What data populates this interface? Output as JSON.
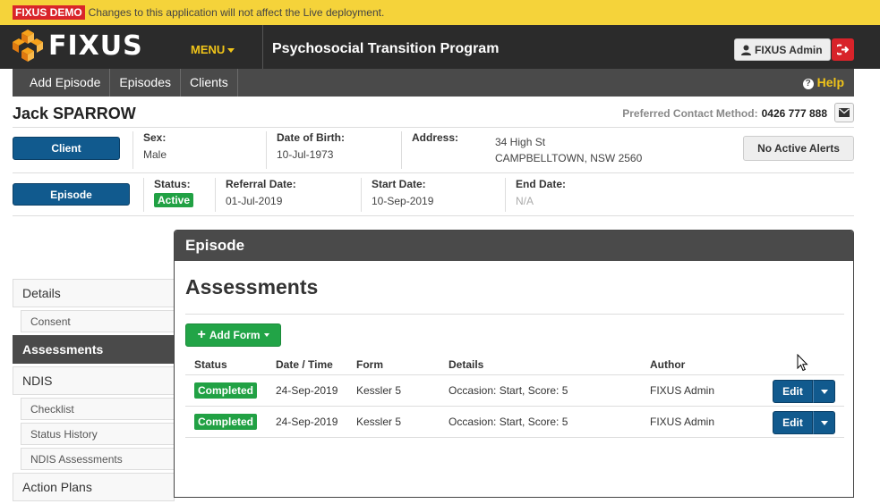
{
  "demo": {
    "badge": "FIXUS DEMO",
    "message": "Changes to this application will not affect the Live deployment."
  },
  "topnav": {
    "logo_text": "FIXUS",
    "menu_label": "MENU",
    "program_title": "Psychosocial Transition Program",
    "user_label": "FIXUS Admin",
    "logout_icon": "logout-icon"
  },
  "subnav": {
    "items": [
      "Add Episode",
      "Episodes",
      "Clients"
    ],
    "help_label": "Help"
  },
  "client": {
    "name": "Jack SPARROW",
    "contact_label": "Preferred Contact Method:",
    "contact_value": "0426 777 888",
    "client_button": "Client",
    "sex_label": "Sex:",
    "sex_value": "Male",
    "dob_label": "Date of Birth:",
    "dob_value": "10-Jul-1973",
    "address_label": "Address:",
    "address_line1": "34 High St",
    "address_line2": "CAMPBELLTOWN, NSW 2560",
    "alerts_button": "No Active Alerts"
  },
  "episode": {
    "episode_button": "Episode",
    "status_label": "Status:",
    "status_value": "Active",
    "referral_label": "Referral Date:",
    "referral_value": "01-Jul-2019",
    "start_label": "Start Date:",
    "start_value": "10-Sep-2019",
    "end_label": "End Date:",
    "end_value": "N/A"
  },
  "sidebar": {
    "items": [
      {
        "label": "Details"
      },
      {
        "label": "Consent"
      },
      {
        "label": "Assessments"
      },
      {
        "label": "NDIS"
      },
      {
        "label": "Checklist"
      },
      {
        "label": "Status History"
      },
      {
        "label": "NDIS Assessments"
      },
      {
        "label": "Action Plans"
      }
    ]
  },
  "panel": {
    "header": "Episode",
    "title": "Assessments",
    "add_form_label": "Add Form",
    "columns": [
      "Status",
      "Date / Time",
      "Form",
      "Details",
      "Author"
    ],
    "rows": [
      {
        "status": "Completed",
        "datetime": "24-Sep-2019",
        "form": "Kessler 5",
        "details": "Occasion: Start, Score: 5",
        "author": "FIXUS Admin",
        "edit": "Edit"
      },
      {
        "status": "Completed",
        "datetime": "24-Sep-2019",
        "form": "Kessler 5",
        "details": "Occasion: Start, Score: 5",
        "author": "FIXUS Admin",
        "edit": "Edit"
      }
    ]
  },
  "colors": {
    "brand_yellow": "#f5d33a",
    "nav_dark": "#2b2b2b",
    "primary_blue": "#115a8e",
    "success_green": "#21a144",
    "danger_red": "#d8232a"
  }
}
